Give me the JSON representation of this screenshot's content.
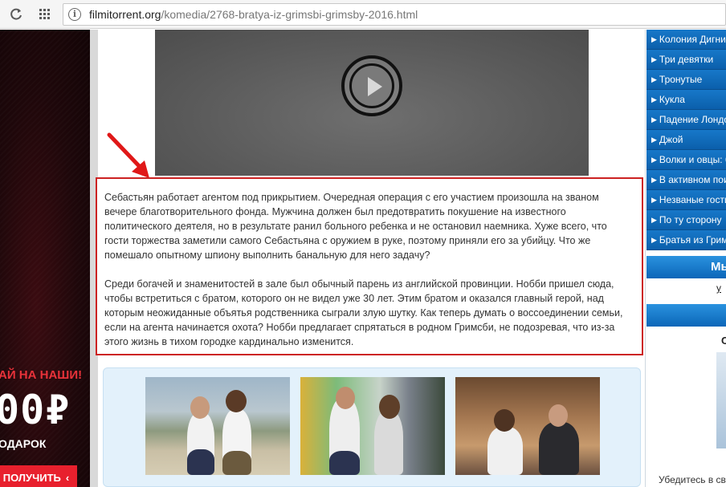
{
  "browser": {
    "url_domain": "filmitorrent.org",
    "url_path": "/komedia/2768-bratya-iz-grimsbi-grimsby-2016.html",
    "back_icon": "refresh-icon",
    "apps_icon": "apps-grid-icon"
  },
  "left_banner": {
    "promo": "АЙ НА НАШИ!",
    "amount": "00₽",
    "gift": "ОДАРОК",
    "button": "ПОЛУЧИТЬ",
    "button_arrow": "‹"
  },
  "description": {
    "paragraph1": "Себастьян работает агентом под прикрытием. Очередная операция с его участием произошла на званом вечере благотворительного фонда. Мужчина должен был предотвратить покушение на известного политического деятеля, но в результате ранил больного ребенка и не остановил наемника. Хуже всего, что гости торжества заметили самого Себастьяна с оружием в руке, поэтому приняли его за убийцу. Что же помешало опытному шпиону выполнить банальную для него задачу?",
    "paragraph2": "Среди богачей и знаменитостей в зале был обычный парень из английской провинции. Нобби пришел сюда, чтобы встретиться с братом, которого он не видел уже 30 лет. Этим братом и оказался главный герой, над которым неожиданные объятья родственника сыграли злую шутку. Как теперь думать о воссоединении семьи, если на агента начинается охота? Нобби предлагает спрятаться в родном Гримсби, не подозревая, что из-за этого жизнь в тихом городке кардинально изменится."
  },
  "sidebar": {
    "items": [
      "Колония Дигнидад",
      "Три девятки",
      "Тронутые",
      "Кукла",
      "Падение Лондона",
      "Джой",
      "Волки и овцы: бээ",
      "В активном поиске",
      "Незваные гости",
      "По ту сторону",
      "Братья из Гримсби"
    ],
    "header1": "Мы",
    "link": "у",
    "panel_title": "С",
    "caption": "Убедитесь в св"
  },
  "colors": {
    "sidebar_blue": "#0b5fab",
    "highlight_red": "#cc2222",
    "gallery_bg": "#e3f1fb"
  }
}
